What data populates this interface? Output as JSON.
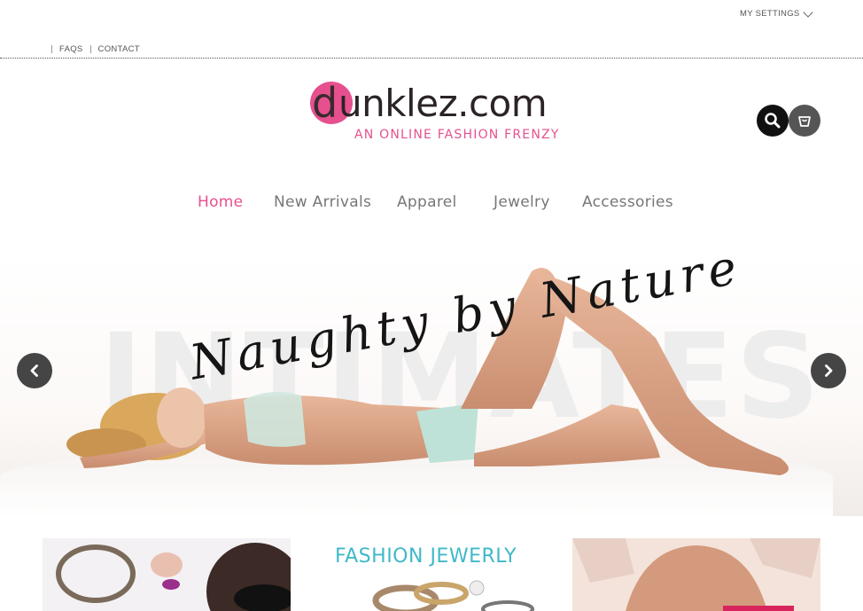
{
  "utility": {
    "settings_label": "MY SETTINGS",
    "links": [
      "FAQS",
      "CONTACT"
    ]
  },
  "logo": {
    "initial": "d",
    "name": "unklez.com",
    "tagline": "AN ONLINE FASHION FRENZY"
  },
  "header_icons": [
    "search-icon",
    "cart-icon"
  ],
  "nav": {
    "items": [
      "Home",
      "New Arrivals",
      "Apparel",
      "Jewelry",
      "Accessories"
    ],
    "active": "Home"
  },
  "hero": {
    "background_word": "INTIMATES",
    "script_text": "Naughty by Nature",
    "prev_icon": "chevron-left-icon",
    "next_icon": "chevron-right-icon"
  },
  "tiles": {
    "jewelry_title": "FASHION JEWERLY"
  },
  "colors": {
    "brand_pink": "#e6508f",
    "jewelry_teal": "#3fb9c8",
    "arrow_gray": "#454545"
  }
}
